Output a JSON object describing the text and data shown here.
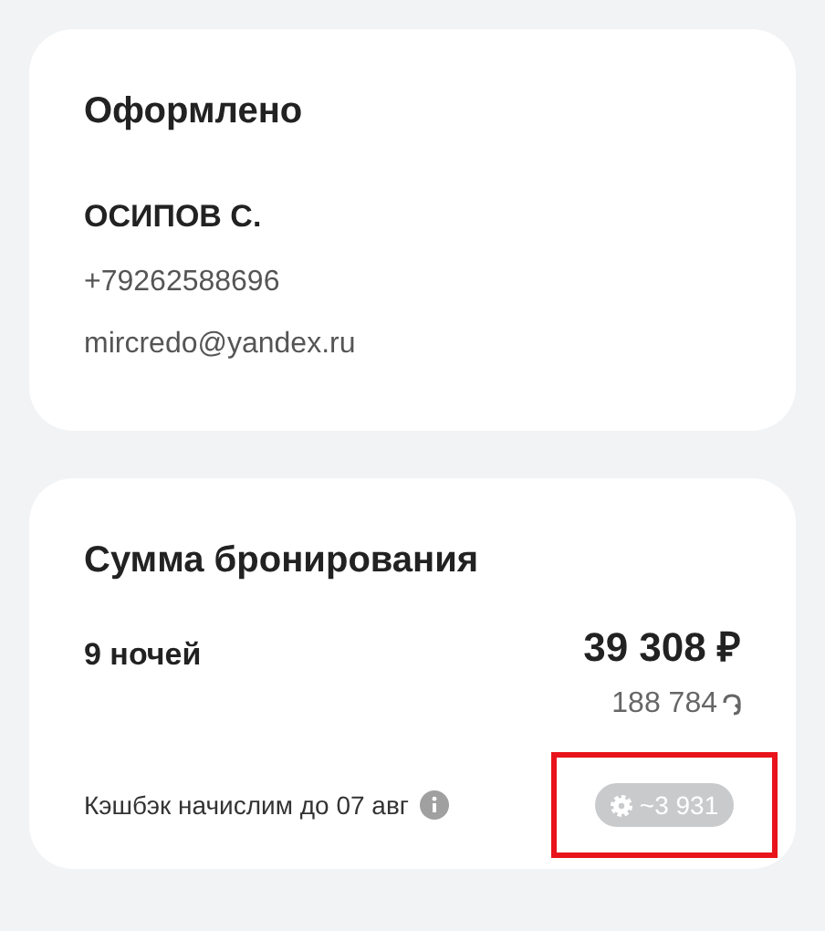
{
  "issued_card": {
    "title": "Оформлено",
    "name": "ОСИПОВ С.",
    "phone": "+79262588696",
    "email": "mircredo@yandex.ru"
  },
  "booking_sum_card": {
    "title": "Сумма бронирования",
    "nights": "9 ночей",
    "price": "39 308 ₽",
    "points": "188 784",
    "cashback_label": "Кэшбэк начислим до 07 авг",
    "cashback_amount": "~3 931",
    "highlighted": true
  }
}
